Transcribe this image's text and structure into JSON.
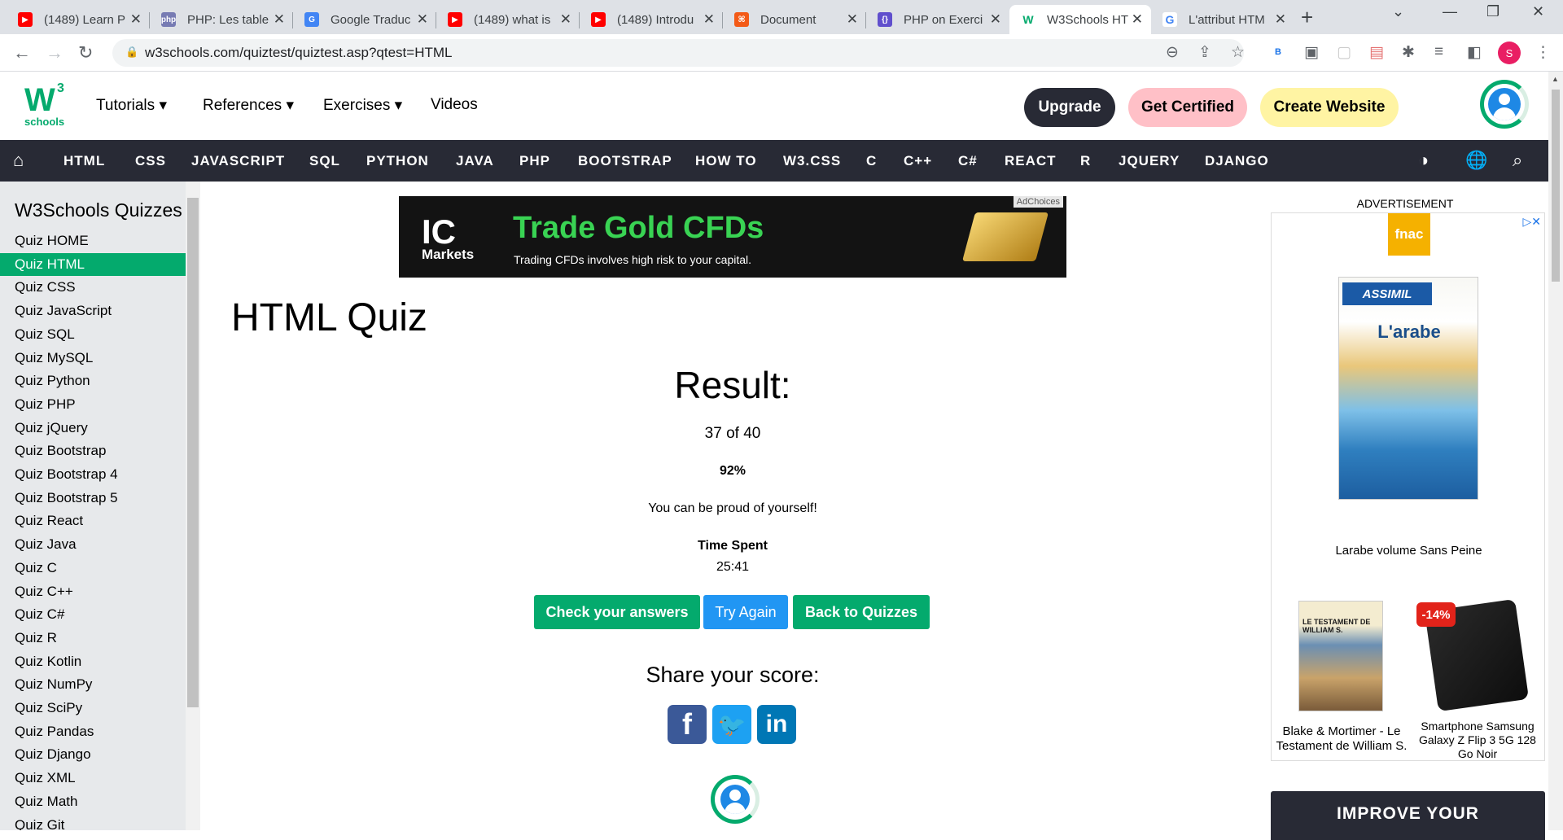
{
  "browser": {
    "tabs": [
      {
        "title": "(1489) Learn P",
        "icon": "youtube-icon",
        "color": "#ff0000"
      },
      {
        "title": "PHP: Les table",
        "icon": "php-icon",
        "color": "#777bb3"
      },
      {
        "title": "Google Traduc",
        "icon": "google-translate-icon",
        "color": "#4285f4"
      },
      {
        "title": "(1489) what is",
        "icon": "youtube-icon",
        "color": "#ff0000"
      },
      {
        "title": "(1489) Introdu",
        "icon": "youtube-icon",
        "color": "#ff0000"
      },
      {
        "title": "Document",
        "icon": "codepen-icon",
        "color": "#f35a17"
      },
      {
        "title": "PHP on Exerci",
        "icon": "exercism-icon",
        "color": "#604fcd"
      },
      {
        "title": "W3Schools HT",
        "icon": "w3schools-icon",
        "color": "#04aa6d"
      },
      {
        "title": "L'attribut HTM",
        "icon": "google-icon",
        "color": "#4285f4"
      }
    ],
    "url": "w3schools.com/quiztest/quiztest.asp?qtest=HTML",
    "profile_initial": "S"
  },
  "header": {
    "logo_mark": "W",
    "logo_sup": "3",
    "logo_text": "schools",
    "menu": [
      "Tutorials",
      "References",
      "Exercises",
      "Videos"
    ],
    "upgrade": "Upgrade",
    "certified": "Get Certified",
    "create": "Create Website"
  },
  "topnav": [
    "HTML",
    "CSS",
    "JAVASCRIPT",
    "SQL",
    "PYTHON",
    "JAVA",
    "PHP",
    "BOOTSTRAP",
    "HOW TO",
    "W3.CSS",
    "C",
    "C++",
    "C#",
    "REACT",
    "R",
    "JQUERY",
    "DJANGO"
  ],
  "sidebar": {
    "title": "W3Schools Quizzes",
    "items": [
      "Quiz HOME",
      "Quiz HTML",
      "Quiz CSS",
      "Quiz JavaScript",
      "Quiz SQL",
      "Quiz MySQL",
      "Quiz Python",
      "Quiz PHP",
      "Quiz jQuery",
      "Quiz Bootstrap",
      "Quiz Bootstrap 4",
      "Quiz Bootstrap 5",
      "Quiz React",
      "Quiz Java",
      "Quiz C",
      "Quiz C++",
      "Quiz C#",
      "Quiz R",
      "Quiz Kotlin",
      "Quiz NumPy",
      "Quiz SciPy",
      "Quiz Pandas",
      "Quiz Django",
      "Quiz XML",
      "Quiz Math",
      "Quiz Git"
    ],
    "active_index": 1
  },
  "ad_banner": {
    "brand": "IC",
    "brand_sub": "Markets",
    "headline": "Trade Gold CFDs",
    "subline": "Trading CFDs involves high risk to your capital.",
    "adchoices": "AdChoices"
  },
  "quiz": {
    "title": "HTML Quiz",
    "result_heading": "Result:",
    "score": "37 of 40",
    "percent": "92%",
    "message": "You can be proud of yourself!",
    "time_label": "Time Spent",
    "time_value": "25:41",
    "buttons": {
      "check": "Check your answers",
      "again": "Try Again",
      "back": "Back to Quizzes"
    },
    "share_heading": "Share your score:"
  },
  "right_ad": {
    "label": "ADVERTISEMENT",
    "store": "fnac",
    "book_brand": "ASSIMIL",
    "book_title": "L'arabe",
    "product1": "Larabe volume Sans Peine",
    "product2": "Blake & Mortimer - Le Testament de William S.",
    "product3": "Smartphone Samsung Galaxy Z Flip 3 5G 128 Go Noir",
    "discount": "-14%",
    "comic_title": "LE TESTAMENT DE WILLIAM S.",
    "improve": "IMPROVE YOUR"
  },
  "colors": {
    "brand_green": "#04aa6d",
    "dark_nav": "#282a35",
    "try_again_blue": "#2196f3",
    "facebook": "#3b5998",
    "twitter": "#1da1f2",
    "linkedin": "#0077b5"
  }
}
